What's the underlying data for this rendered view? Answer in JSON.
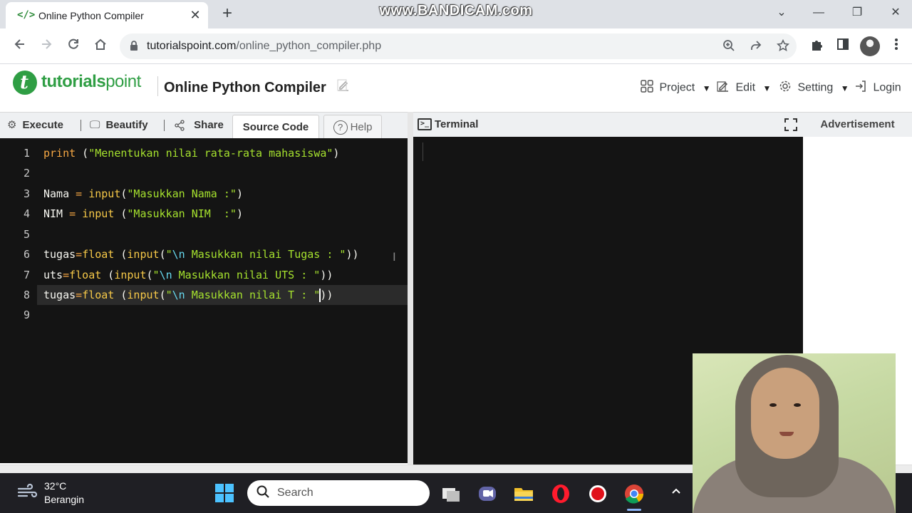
{
  "browser": {
    "tab_title": "Online Python Compiler",
    "tab_favicon": "</>",
    "tab_close": "✕",
    "new_tab": "+",
    "watermark": "www.BANDICAM.com",
    "url_host": "tutorialspoint.com",
    "url_path": "/online_python_compiler.php",
    "window_controls": {
      "collapse": "⌄",
      "minimize": "—",
      "restore": "❐",
      "close": "✕"
    }
  },
  "site": {
    "logo_bold": "tutorials",
    "logo_light": "point",
    "logo_mark": "t",
    "page_title": "Online Python Compiler",
    "menu": {
      "project": "Project",
      "edit": "Edit",
      "setting": "Setting",
      "login": "Login"
    }
  },
  "ide": {
    "toolbar": {
      "execute": "Execute",
      "beautify": "Beautify",
      "share": "Share",
      "source_code": "Source Code",
      "help": "Help",
      "separator": "|"
    },
    "line_numbers": [
      "1",
      "2",
      "3",
      "4",
      "5",
      "6",
      "7",
      "8",
      "9"
    ],
    "active_line": 8,
    "code": {
      "l1": {
        "kw": "print",
        "pre": " (",
        "str": "\"Menentukan nilai rata-rata mahasiswa\"",
        "post": ")"
      },
      "l3": {
        "var": "Nama ",
        "op": "= ",
        "fn": "input",
        "pre": "(",
        "str": "\"Masukkan Nama :\"",
        "post": ")"
      },
      "l4": {
        "var": "NIM ",
        "op": "= ",
        "fn": "input",
        "pre": " (",
        "str": "\"Masukkan NIM  :\"",
        "post": ")"
      },
      "l6": {
        "var": "tugas",
        "op": "=",
        "fn1": "float",
        "mid": " (",
        "fn2": "input",
        "pre": "(",
        "q": "\"",
        "esc": "\\n",
        "str": " Masukkan nilai Tugas : \"",
        "post": "))"
      },
      "l7": {
        "var": "uts",
        "op": "=",
        "fn1": "float",
        "mid": " (",
        "fn2": "input",
        "pre": "(",
        "q": "\"",
        "esc": "\\n",
        "str": " Masukkan nilai UTS : \"",
        "post": "))"
      },
      "l8": {
        "var": "tugas",
        "op": "=",
        "fn1": "float",
        "mid": " (",
        "fn2": "input",
        "pre": "(",
        "q": "\"",
        "esc": "\\n",
        "str": " Masukkan nilai T : \"",
        "post": "))"
      }
    },
    "terminal_label": "Terminal",
    "advertisement_label": "Advertisement"
  },
  "taskbar": {
    "weather_temp": "32°C",
    "weather_desc": "Berangin",
    "search_label": "Search"
  },
  "icons": {
    "back": "arrow-left-icon",
    "forward": "arrow-right-icon",
    "reload": "reload-icon",
    "home": "home-icon",
    "lock": "lock-icon",
    "zoom": "zoom-icon",
    "share": "share-icon",
    "star": "star-icon",
    "extensions": "puzzle-icon",
    "sidepanel": "side-panel-icon",
    "menu": "kebab-menu-icon"
  },
  "colors": {
    "brand_green": "#2f9e44",
    "editor_bg": "#141414",
    "keyword": "#f7a844",
    "string": "#a6e22e",
    "escape": "#66d9ef"
  }
}
